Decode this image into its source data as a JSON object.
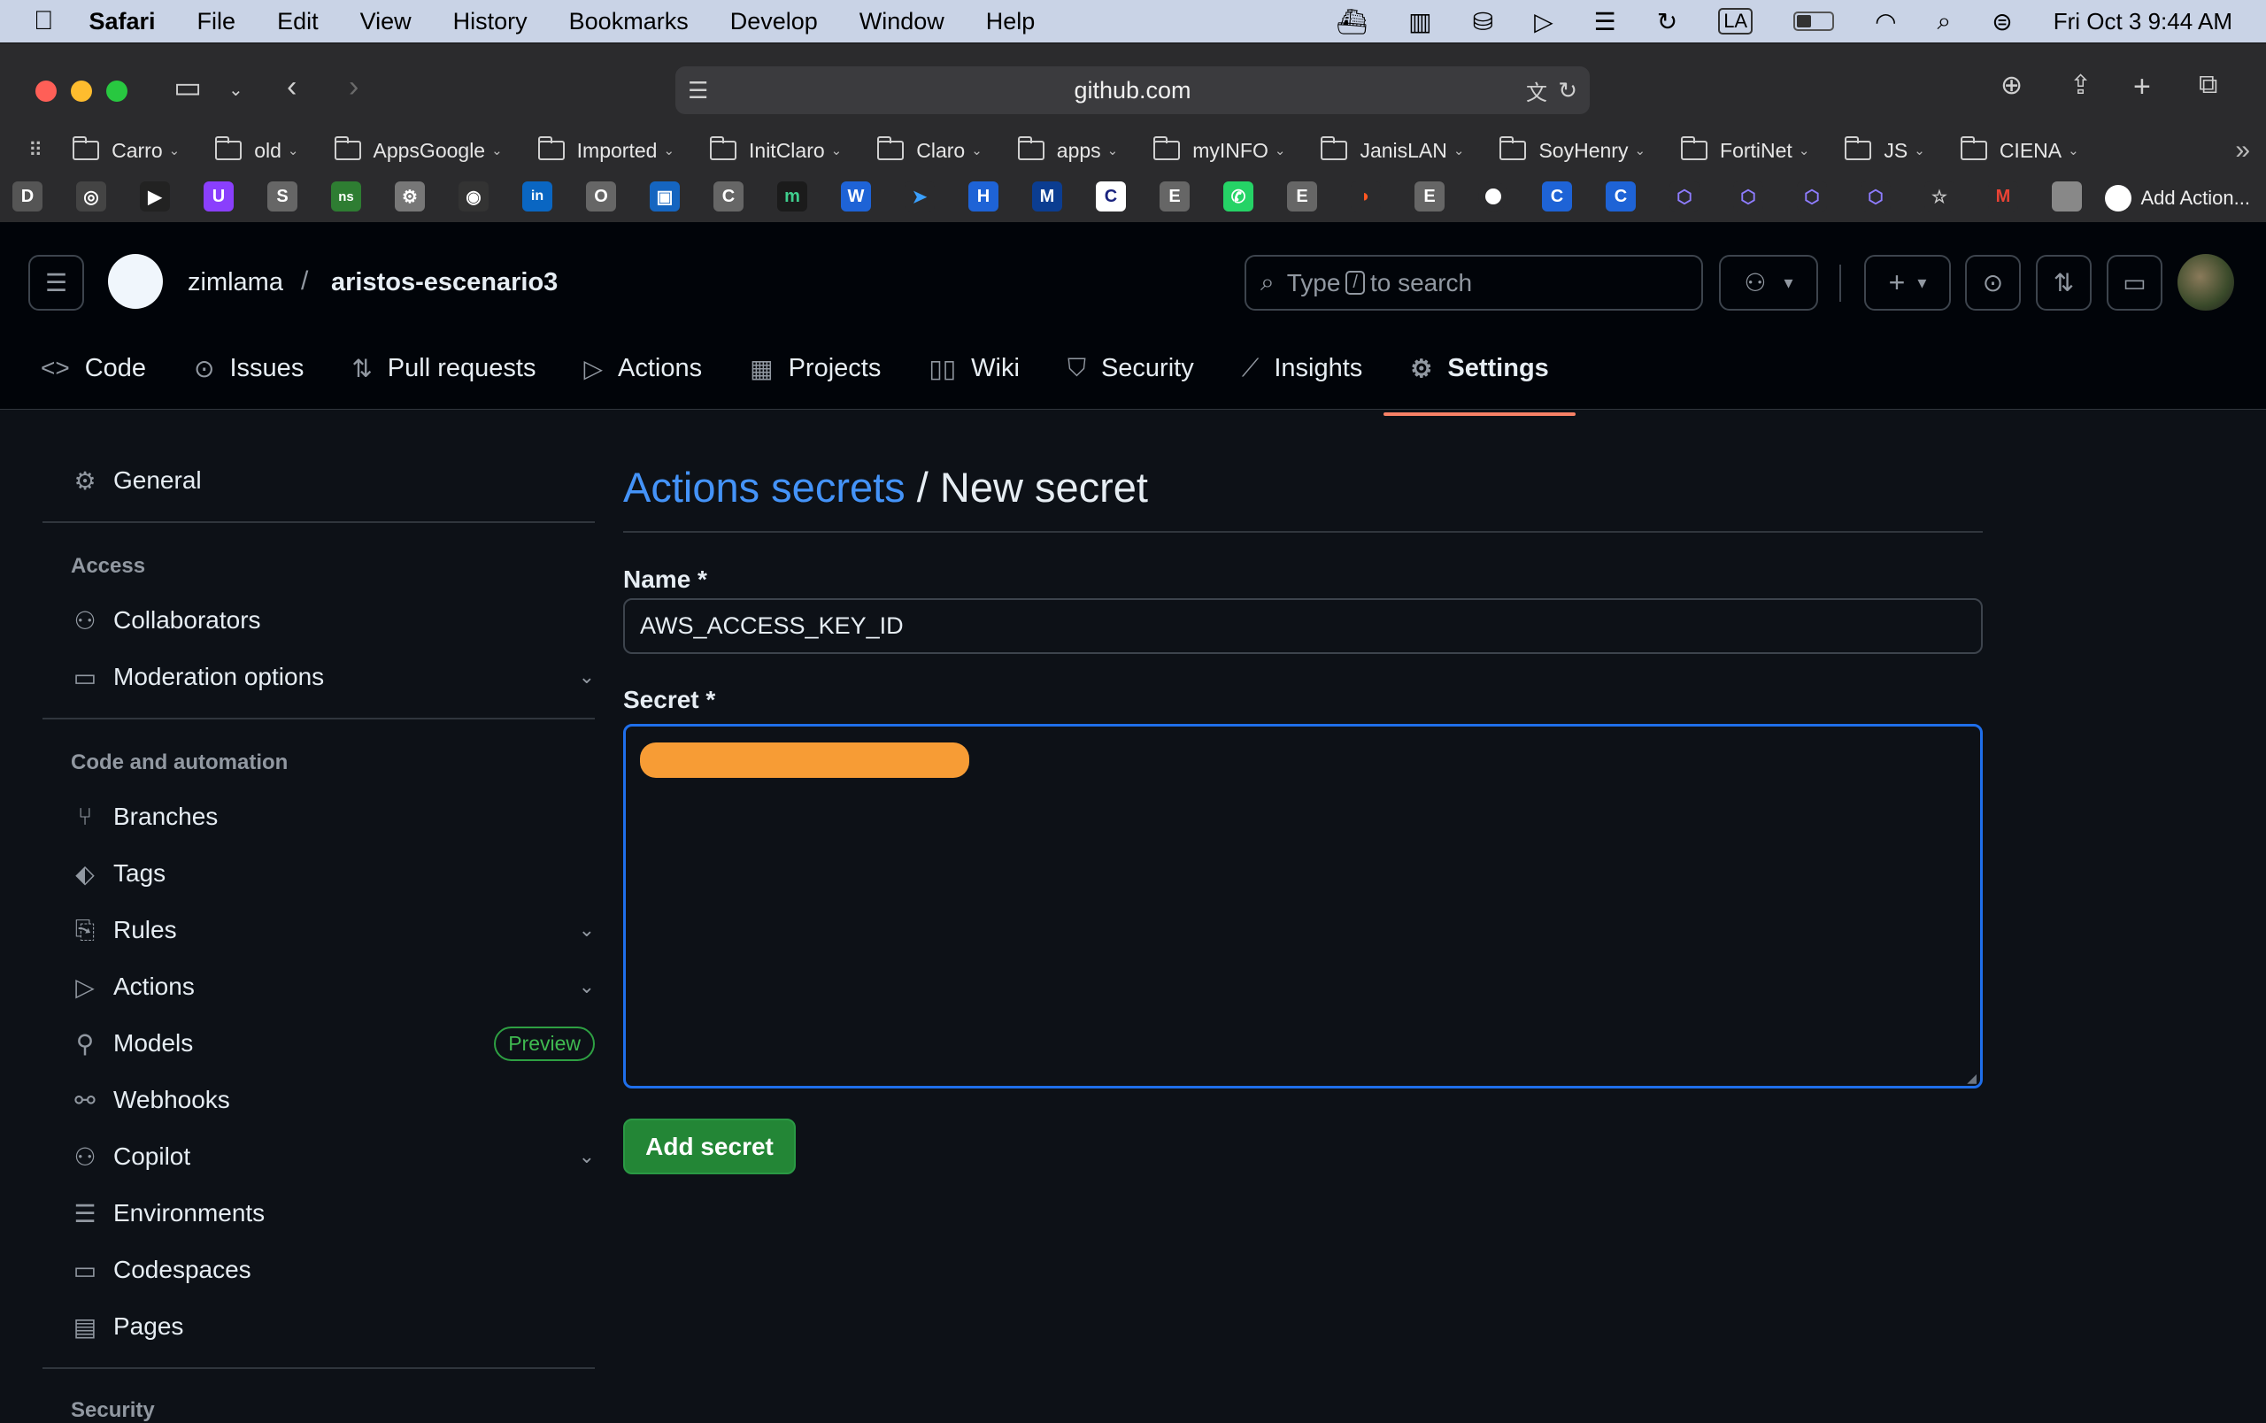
{
  "menubar": {
    "apple": "",
    "app": "Safari",
    "items": [
      "File",
      "Edit",
      "View",
      "History",
      "Bookmarks",
      "Develop",
      "Window",
      "Help"
    ],
    "input_source": "LA",
    "clock": "Fri Oct 3  9:44 AM"
  },
  "browser": {
    "url": "github.com",
    "favorites": [
      "Carro",
      "old",
      "AppsGoogle",
      "Imported",
      "InitClaro",
      "Claro",
      "apps",
      "myINFO",
      "JanisLAN",
      "SoyHenry",
      "FortiNet",
      "JS",
      "CIENA"
    ],
    "bookmark_icons": [
      "D",
      "◎",
      "▶",
      "U",
      "S",
      "ns",
      "⚙",
      "◉",
      "in",
      "O",
      "▣",
      "C",
      "m",
      "W",
      "➤",
      "H",
      "M",
      "C",
      "E",
      "✆",
      "E",
      "◗",
      "E",
      "",
      "C",
      "C",
      "⬡",
      "⬡",
      "⬡",
      "⬡",
      "☆",
      "M",
      ""
    ],
    "add_action": "Add Action..."
  },
  "github": {
    "owner": "zimlama",
    "separator": "/",
    "repo": "aristos-escenario3",
    "search_prefix": "Type",
    "search_key": "/",
    "search_suffix": "to search",
    "tabs": [
      {
        "label": "Code",
        "icon": "code-icon"
      },
      {
        "label": "Issues",
        "icon": "issue-icon"
      },
      {
        "label": "Pull requests",
        "icon": "pull-request-icon"
      },
      {
        "label": "Actions",
        "icon": "play-icon"
      },
      {
        "label": "Projects",
        "icon": "table-icon"
      },
      {
        "label": "Wiki",
        "icon": "book-icon"
      },
      {
        "label": "Security",
        "icon": "shield-icon"
      },
      {
        "label": "Insights",
        "icon": "graph-icon"
      },
      {
        "label": "Settings",
        "icon": "gear-icon"
      }
    ],
    "selected_tab": "Settings"
  },
  "sidebar": {
    "general": "General",
    "access_heading": "Access",
    "collaborators": "Collaborators",
    "moderation": "Moderation options",
    "code_heading": "Code and automation",
    "branches": "Branches",
    "tags": "Tags",
    "rules": "Rules",
    "actions": "Actions",
    "models": "Models",
    "models_badge": "Preview",
    "webhooks": "Webhooks",
    "copilot": "Copilot",
    "environments": "Environments",
    "codespaces": "Codespaces",
    "pages": "Pages",
    "security_heading": "Security"
  },
  "form": {
    "breadcrumb_link": "Actions secrets",
    "breadcrumb_sep": " / ",
    "title": "New secret",
    "name_label": "Name *",
    "name_value": "AWS_ACCESS_KEY_ID",
    "secret_label": "Secret *",
    "submit": "Add secret"
  },
  "colors": {
    "accent": "#4493f8",
    "primary_button": "#238636",
    "underline": "#f78166",
    "redaction": "#f79c35"
  }
}
